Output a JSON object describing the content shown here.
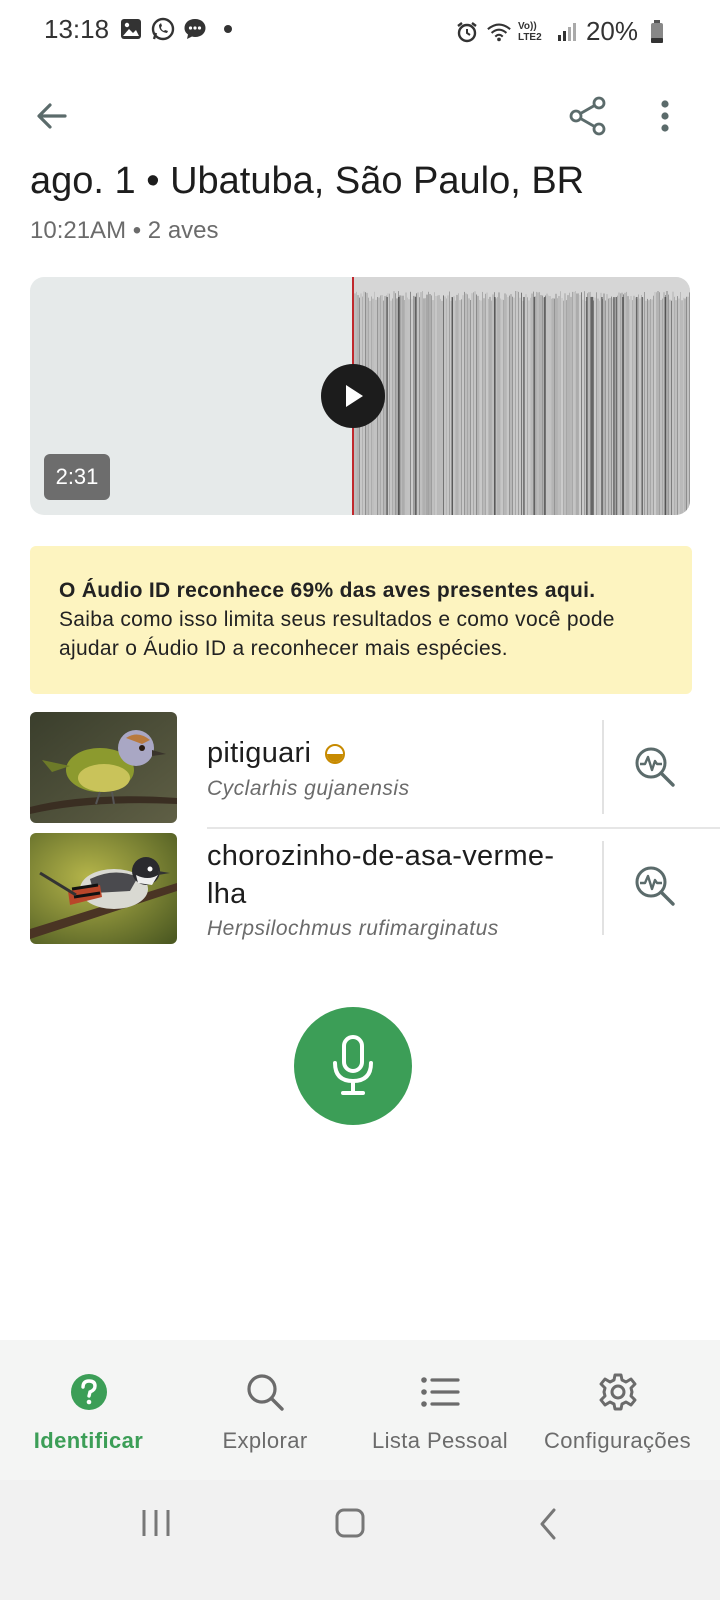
{
  "status_bar": {
    "time": "13:18",
    "battery": "20%",
    "left_icons": [
      "gallery-icon",
      "whatsapp-icon",
      "message-icon",
      "dot-icon"
    ],
    "right_icons": [
      "alarm-icon",
      "wifi-icon",
      "volte-icon",
      "signal-icon",
      "battery-icon"
    ],
    "volte_label": "Vo)) LTE2"
  },
  "header": {
    "title": "ago. 1 • Ubatuba, São Paulo, BR",
    "subtitle": "10:21AM • 2 aves"
  },
  "recording": {
    "duration": "2:31",
    "playhead_color": "#c0282d"
  },
  "notice": {
    "bold": "O Áudio ID reconhece 69% das aves presentes aqui.",
    "text": "Saiba como isso limita seus resultados e como você pode ajudar o Áudio ID a reconhecer mais espécies."
  },
  "results": [
    {
      "common_name": "pitiguari",
      "scientific_name": "Cyclarhis gujanensis",
      "confidence_icon": "half-filled-circle-icon"
    },
    {
      "common_name_line1": "chorozinho-de-asa-verme-",
      "common_name_line2": "lha",
      "scientific_name": "Herpsilochmus rufimarginatus"
    }
  ],
  "bottom_nav": {
    "items": [
      {
        "label": "Identificar",
        "icon": "question-circle-icon",
        "active": true
      },
      {
        "label": "Explorar",
        "icon": "search-icon",
        "active": false
      },
      {
        "label": "Lista Pessoal",
        "icon": "list-icon",
        "active": false
      },
      {
        "label": "Configurações",
        "icon": "gear-icon",
        "active": false
      }
    ]
  },
  "colors": {
    "accent": "#3c9e57",
    "notice_bg": "#fdf4c0",
    "confidence": "#c78a00"
  }
}
